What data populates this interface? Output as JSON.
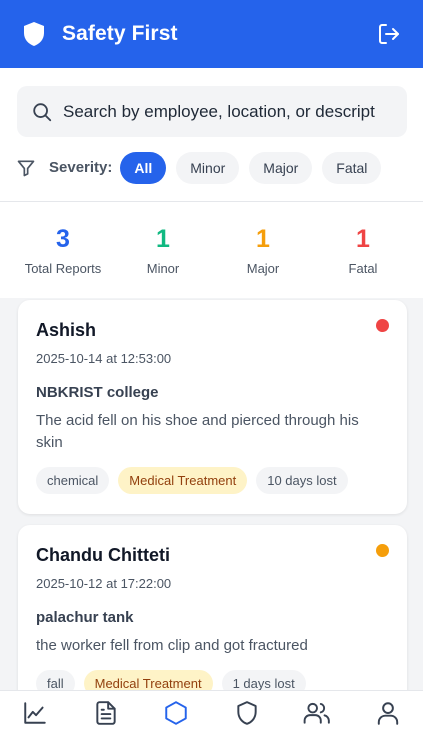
{
  "header": {
    "title": "Safety First"
  },
  "search": {
    "placeholder": "Search by employee, location, or descript"
  },
  "filters": {
    "label": "Severity:",
    "options": [
      "All",
      "Minor",
      "Major",
      "Fatal"
    ],
    "selected": "All"
  },
  "stats": [
    {
      "value": "3",
      "label": "Total Reports",
      "color": "#2563eb"
    },
    {
      "value": "1",
      "label": "Minor",
      "color": "#10b981"
    },
    {
      "value": "1",
      "label": "Major",
      "color": "#f59e0b"
    },
    {
      "value": "1",
      "label": "Fatal",
      "color": "#ef4444"
    }
  ],
  "reports": [
    {
      "employee": "Ashish",
      "datetime": "2025-10-14 at 12:53:00",
      "location": "NBKRIST college",
      "description": "The acid fell on his shoe and pierced through his skin",
      "severity_color": "#ef4444",
      "tags": [
        "chemical",
        "Medical Treatment",
        "10 days lost"
      ]
    },
    {
      "employee": "Chandu Chitteti",
      "datetime": "2025-10-12 at 17:22:00",
      "location": "palachur tank",
      "description": "the worker fell from clip and got fractured",
      "severity_color": "#f59e0b",
      "tags": [
        "fall",
        "Medical Treatment",
        "1 days lost"
      ]
    }
  ],
  "bottom_nav": {
    "items": [
      "analytics-icon",
      "reports-icon",
      "incidents-icon",
      "safety-icon",
      "team-icon",
      "profile-icon"
    ],
    "active": "incidents-icon"
  },
  "colors": {
    "primary": "#2563eb",
    "minor": "#10b981",
    "major": "#f59e0b",
    "fatal": "#ef4444"
  }
}
